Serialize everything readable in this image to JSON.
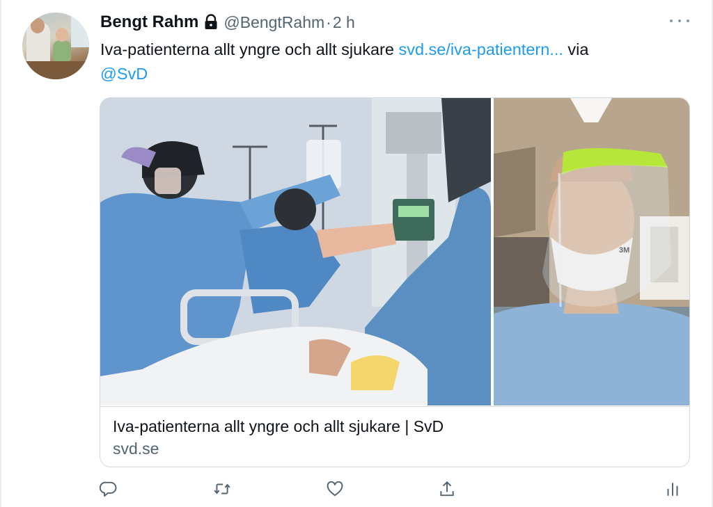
{
  "tweet": {
    "author": {
      "display_name": "Bengt Rahm",
      "handle": "@BengtRahm",
      "separator": "·",
      "time_ago": "2 h",
      "protected_icon": "lock-icon"
    },
    "text": {
      "body": "Iva-patienterna allt yngre och allt sjukare ",
      "link": "svd.se/iva-patientern...",
      "via": " via ",
      "mention": "@SvD"
    },
    "card": {
      "title": "Iva-patienterna allt yngre och allt sjukare | SvD",
      "domain": "svd.se"
    },
    "actions": {
      "icons": [
        "reply-icon",
        "retweet-icon",
        "like-icon",
        "share-icon",
        "analytics-icon"
      ]
    },
    "colors": {
      "link": "#1d9bf0",
      "secondary_text": "#536471",
      "border": "#cfd9de"
    }
  }
}
